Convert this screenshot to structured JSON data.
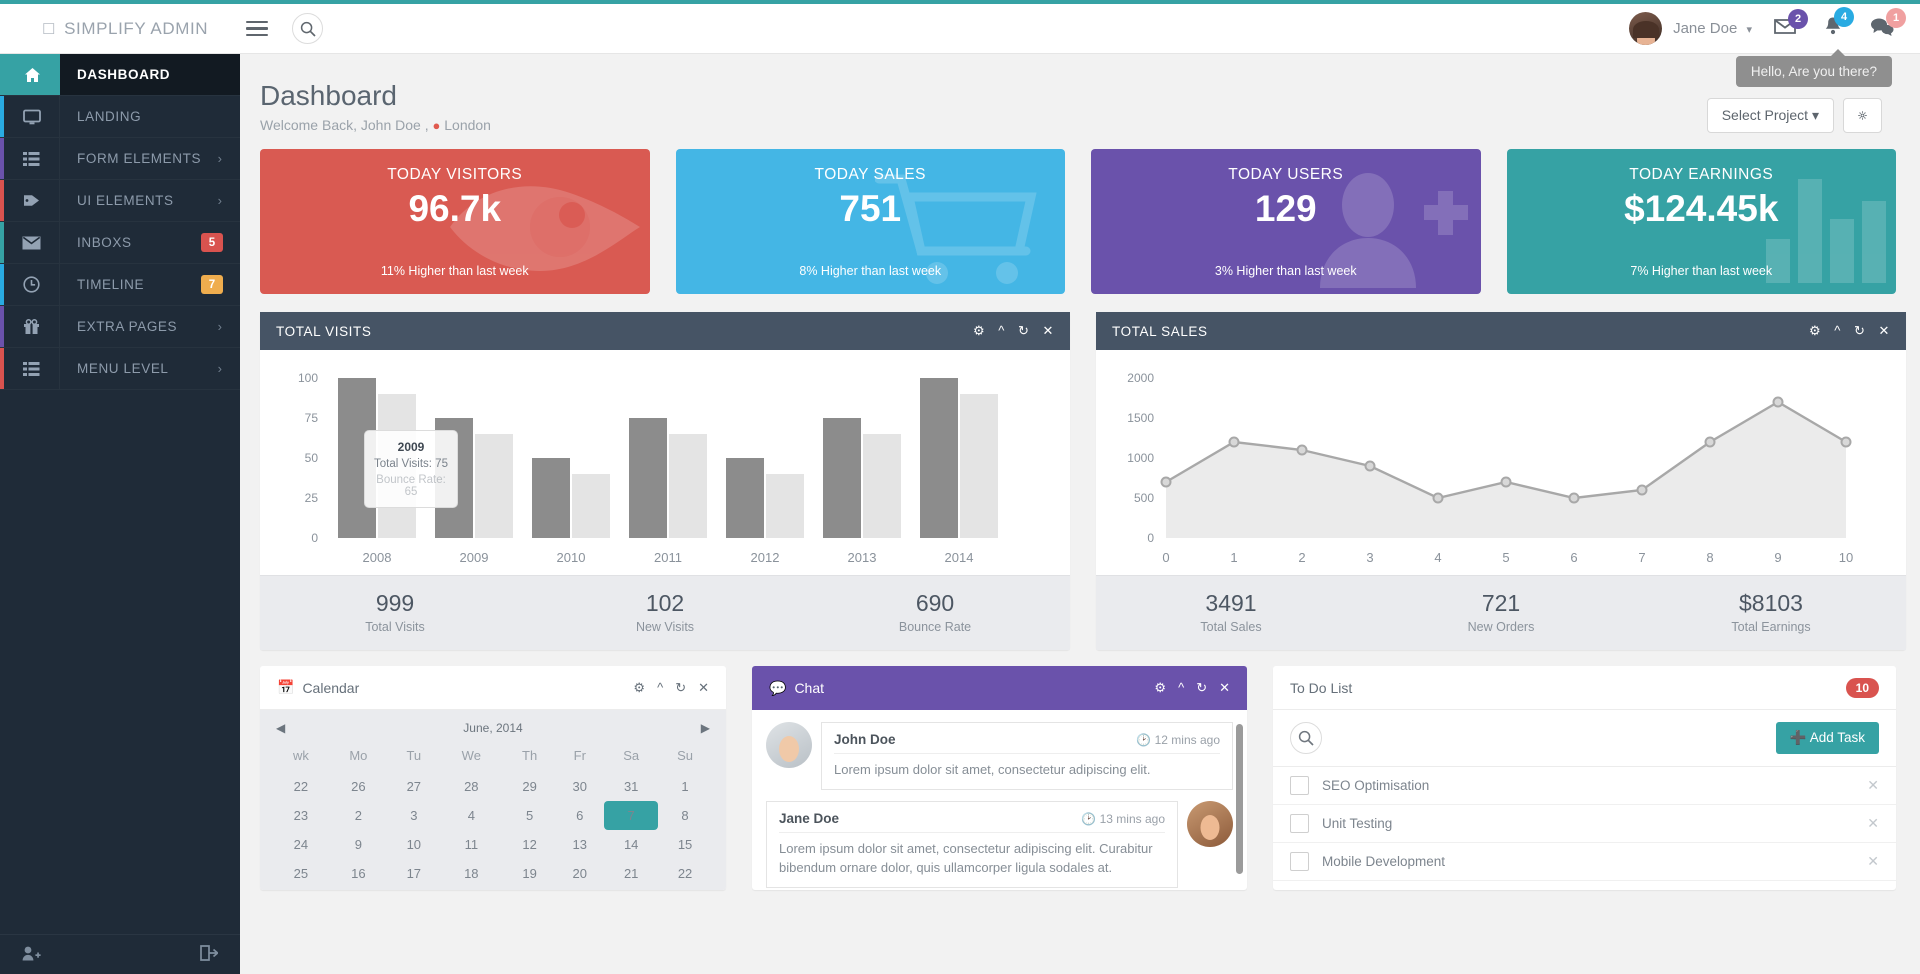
{
  "header": {
    "brand": "SIMPLIFY ADMIN",
    "brand_glyph": "box-glyph",
    "menu_icon": "hamburger-icon",
    "search_icon": "search-icon",
    "user_name": "Jane Doe",
    "notifications": [
      {
        "icon": "envelope-icon",
        "count": "2",
        "color": "#6a52ab"
      },
      {
        "icon": "bell-icon",
        "count": "4",
        "color": "#29abe2"
      },
      {
        "icon": "comment-icon",
        "count": "1",
        "color": "#f0a0a0"
      }
    ],
    "tooltip": "Hello, Are you there?"
  },
  "sidebar": {
    "items": [
      {
        "label": "DASHBOARD",
        "icon": "home-icon",
        "accent": "#36a2a4",
        "active": true,
        "badge": null,
        "badge_color": null,
        "arrow": false
      },
      {
        "label": "LANDING",
        "icon": "monitor-icon",
        "accent": "#29abe2",
        "active": false,
        "badge": null,
        "badge_color": null,
        "arrow": false
      },
      {
        "label": "FORM ELEMENTS",
        "icon": "list-icon",
        "accent": "#6a52ab",
        "active": false,
        "badge": null,
        "badge_color": null,
        "arrow": true
      },
      {
        "label": "UI ELEMENTS",
        "icon": "tag-icon",
        "accent": "#d9534f",
        "active": false,
        "badge": null,
        "badge_color": null,
        "arrow": true
      },
      {
        "label": "INBOXS",
        "icon": "envelope-icon",
        "accent": "#36a2a4",
        "active": false,
        "badge": "5",
        "badge_color": "#d9534f",
        "arrow": false
      },
      {
        "label": "TIMELINE",
        "icon": "clock-icon",
        "accent": "#29abe2",
        "active": false,
        "badge": "7",
        "badge_color": "#efad4e",
        "arrow": false
      },
      {
        "label": "EXTRA PAGES",
        "icon": "gift-icon",
        "accent": "#6a52ab",
        "active": false,
        "badge": null,
        "badge_color": null,
        "arrow": true
      },
      {
        "label": "MENU LEVEL",
        "icon": "list-icon",
        "accent": "#d9534f",
        "active": false,
        "badge": null,
        "badge_color": null,
        "arrow": true
      }
    ],
    "footer": {
      "left_icon": "add-user-icon",
      "right_icon": "logout-icon"
    }
  },
  "page": {
    "title": "Dashboard",
    "welcome_prefix": "Welcome Back, John Doe ,",
    "location_icon": "map-pin-icon",
    "location": "London",
    "select_project": "Select Project",
    "settings_icon": "gear-icon"
  },
  "stat_cards": [
    {
      "title": "TODAY VISITORS",
      "value": "96.7k",
      "footer": "11% Higher than last week",
      "color": "#d95a52",
      "icon": "eye-icon"
    },
    {
      "title": "TODAY SALES",
      "value": "751",
      "footer": "8% Higher than last week",
      "color": "#44b6e5",
      "icon": "cart-icon"
    },
    {
      "title": "TODAY USERS",
      "value": "129",
      "footer": "3% Higher than last week",
      "color": "#6a52ab",
      "icon": "user-plus-icon"
    },
    {
      "title": "TODAY EARNINGS",
      "value": "$124.45k",
      "footer": "7% Higher than last week",
      "color": "#36a2a4",
      "icon": "bar-chart-icon"
    }
  ],
  "panels": {
    "visits": {
      "title": "TOTAL VISITS",
      "tools": [
        "gear-icon",
        "chevron-up-icon",
        "refresh-icon",
        "close-icon"
      ],
      "tooltip": {
        "title": "2009",
        "line1": "Total Visits: 75",
        "line2": "Bounce Rate: 65"
      },
      "stats": [
        {
          "value": "999",
          "label": "Total Visits"
        },
        {
          "value": "102",
          "label": "New Visits"
        },
        {
          "value": "690",
          "label": "Bounce Rate"
        }
      ]
    },
    "sales": {
      "title": "TOTAL SALES",
      "tools": [
        "gear-icon",
        "chevron-up-icon",
        "refresh-icon",
        "close-icon"
      ],
      "stats": [
        {
          "value": "3491",
          "label": "Total Sales"
        },
        {
          "value": "721",
          "label": "New Orders"
        },
        {
          "value": "$8103",
          "label": "Total Earnings"
        }
      ]
    }
  },
  "chart_data": [
    {
      "type": "bar",
      "title": "TOTAL VISITS",
      "categories": [
        "2008",
        "2009",
        "2010",
        "2011",
        "2012",
        "2013",
        "2014"
      ],
      "series": [
        {
          "name": "Total Visits",
          "values": [
            100,
            75,
            50,
            75,
            50,
            75,
            100
          ],
          "color": "#8c8c8c"
        },
        {
          "name": "Bounce Rate",
          "values": [
            90,
            65,
            40,
            65,
            40,
            65,
            90
          ],
          "color": "#e4e4e4"
        }
      ],
      "xlabel": "",
      "ylabel": "",
      "yticks": [
        0,
        25,
        50,
        75,
        100
      ],
      "ylim": [
        0,
        100
      ],
      "grid": false,
      "legend": "none",
      "annotation": {
        "category": "2009",
        "Total Visits": 75,
        "Bounce Rate": 65
      }
    },
    {
      "type": "area",
      "title": "TOTAL SALES",
      "x": [
        0,
        1,
        2,
        3,
        4,
        5,
        6,
        7,
        8,
        9,
        10
      ],
      "values": [
        700,
        1200,
        1100,
        900,
        500,
        700,
        500,
        600,
        1200,
        1700,
        1200
      ],
      "series_name": "Total Sales",
      "line_color": "#a0a0a0",
      "fill_color": "#ebebeb",
      "xlabel": "",
      "ylabel": "",
      "yticks": [
        0,
        500,
        1000,
        1500,
        2000
      ],
      "ylim": [
        0,
        2000
      ],
      "xlim": [
        0,
        10
      ],
      "grid": false,
      "legend": "none"
    }
  ],
  "calendar": {
    "title": "Calendar",
    "icon": "calendar-icon",
    "tools": [
      "gear-icon",
      "chevron-up-icon",
      "refresh-icon",
      "close-icon"
    ],
    "prev_icon": "triangle-left-icon",
    "next_icon": "triangle-right-icon",
    "month": "June, 2014",
    "headers": [
      "wk",
      "Mo",
      "Tu",
      "We",
      "Th",
      "Fr",
      "Sa",
      "Su"
    ],
    "weeks": [
      {
        "wk": "22",
        "days": [
          "26",
          "27",
          "28",
          "29",
          "30",
          "31",
          "1"
        ],
        "selected": -1
      },
      {
        "wk": "23",
        "days": [
          "2",
          "3",
          "4",
          "5",
          "6",
          "7",
          "8"
        ],
        "selected": 5
      },
      {
        "wk": "24",
        "days": [
          "9",
          "10",
          "11",
          "12",
          "13",
          "14",
          "15"
        ],
        "selected": -1
      },
      {
        "wk": "25",
        "days": [
          "16",
          "17",
          "18",
          "19",
          "20",
          "21",
          "22"
        ],
        "selected": -1
      }
    ]
  },
  "chat": {
    "title": "Chat",
    "icon": "comment-icon",
    "tools": [
      "gear-icon",
      "chevron-up-icon",
      "refresh-icon",
      "close-icon"
    ],
    "messages": [
      {
        "name": "John Doe",
        "time": "12 mins ago",
        "time_icon": "clock-icon",
        "side": "left",
        "text": "Lorem ipsum dolor sit amet, consectetur adipiscing elit."
      },
      {
        "name": "Jane Doe",
        "time": "13 mins ago",
        "time_icon": "clock-icon",
        "side": "right",
        "text": "Lorem ipsum dolor sit amet, consectetur adipiscing elit. Curabitur bibendum ornare dolor, quis ullamcorper ligula sodales at."
      }
    ]
  },
  "todo": {
    "title": "To Do List",
    "badge": "10",
    "search_icon": "search-icon",
    "add_label": "Add Task",
    "add_icon": "plus-icon",
    "items": [
      {
        "label": "SEO Optimisation",
        "checked": false,
        "remove_icon": "close-icon"
      },
      {
        "label": "Unit Testing",
        "checked": false,
        "remove_icon": "close-icon"
      },
      {
        "label": "Mobile Development",
        "checked": false,
        "remove_icon": "close-icon"
      }
    ]
  }
}
